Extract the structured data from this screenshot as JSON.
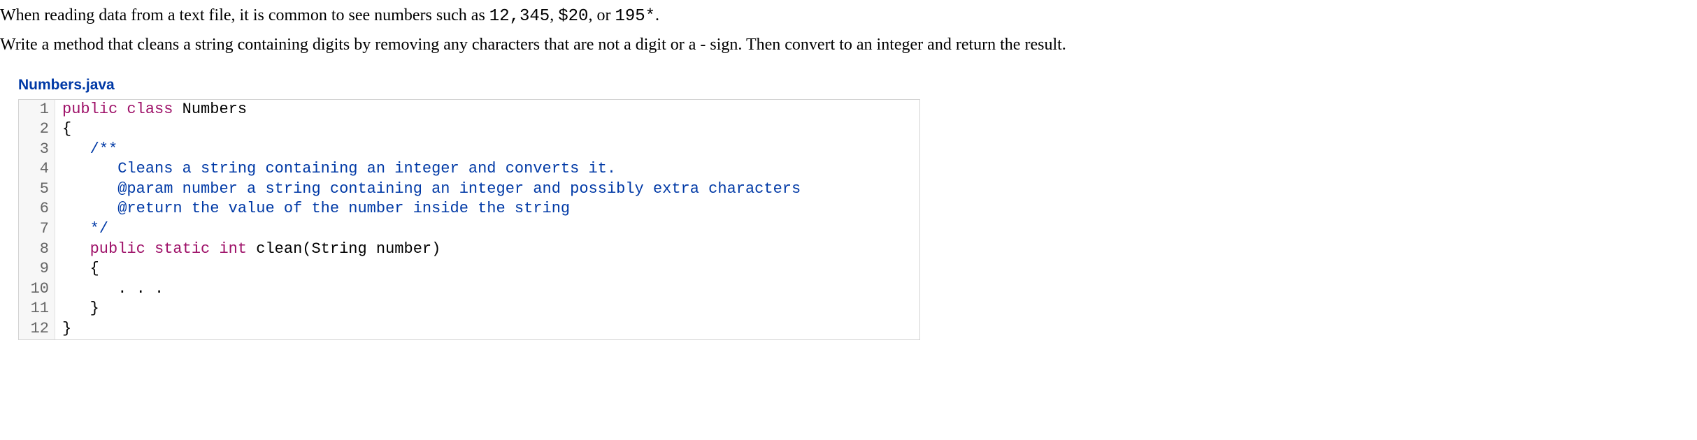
{
  "intro": {
    "part1": "When reading data from a text file, it is common to see numbers such as ",
    "n1": "12,345",
    "sep1": ", ",
    "n2": "$20",
    "sep2": ", or ",
    "n3": "195*",
    "end1": "."
  },
  "instruction": "Write a method that cleans a string containing digits by removing any characters that are not a digit or a - sign. Then convert to an integer and return the result.",
  "filename": "Numbers.java",
  "code": {
    "l1_kw1": "public",
    "l1_kw2": "class",
    "l1_name": " Numbers",
    "l2": "{",
    "l3_indent": "   ",
    "l3_comment": "/**",
    "l4_indent": "      ",
    "l4_comment": "Cleans a string containing an integer and converts it.",
    "l5_indent": "      ",
    "l5_tag": "@param",
    "l5_comment": " number a string containing an integer and possibly extra characters",
    "l6_indent": "      ",
    "l6_tag": "@return",
    "l6_comment": " the value of the number inside the string",
    "l7_indent": "   ",
    "l7_comment": "*/",
    "l8_indent": "   ",
    "l8_kw1": "public",
    "l8_kw2": "static",
    "l8_type": "int",
    "l8_rest": " clean(String number)",
    "l9": "   {",
    "l10": "      . . .",
    "l11": "   }",
    "l12": "}"
  },
  "linenos": [
    "1",
    "2",
    "3",
    "4",
    "5",
    "6",
    "7",
    "8",
    "9",
    "10",
    "11",
    "12"
  ]
}
